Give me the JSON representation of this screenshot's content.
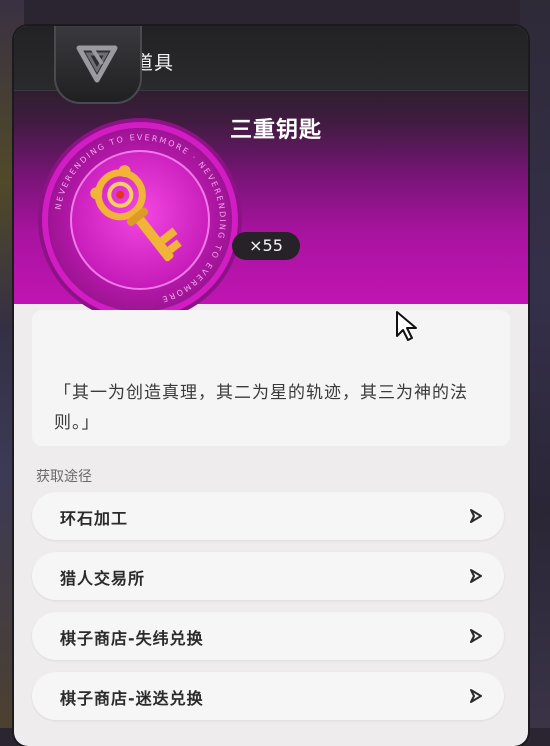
{
  "header": {
    "title": "道具"
  },
  "item": {
    "name": "三重钥匙",
    "count": "×55",
    "ring_text": "NEVERENDING TO EVERMORE"
  },
  "description": {
    "text": "「其一为创造真理，其二为星的轨迹，其三为神的法则。」"
  },
  "sources": {
    "label": "获取途径",
    "items": [
      {
        "label": "环石加工"
      },
      {
        "label": "猎人交易所"
      },
      {
        "label": "棋子商店-失纬兑换"
      },
      {
        "label": "棋子商店-迷迭兑换"
      }
    ]
  },
  "icons": [
    "logo-badge-icon",
    "golden-key-icon",
    "cursor-icon",
    "chevron-right-icon"
  ],
  "colors": {
    "accent": "#c014b2",
    "header": "#262626",
    "panel": "#eeeced"
  }
}
